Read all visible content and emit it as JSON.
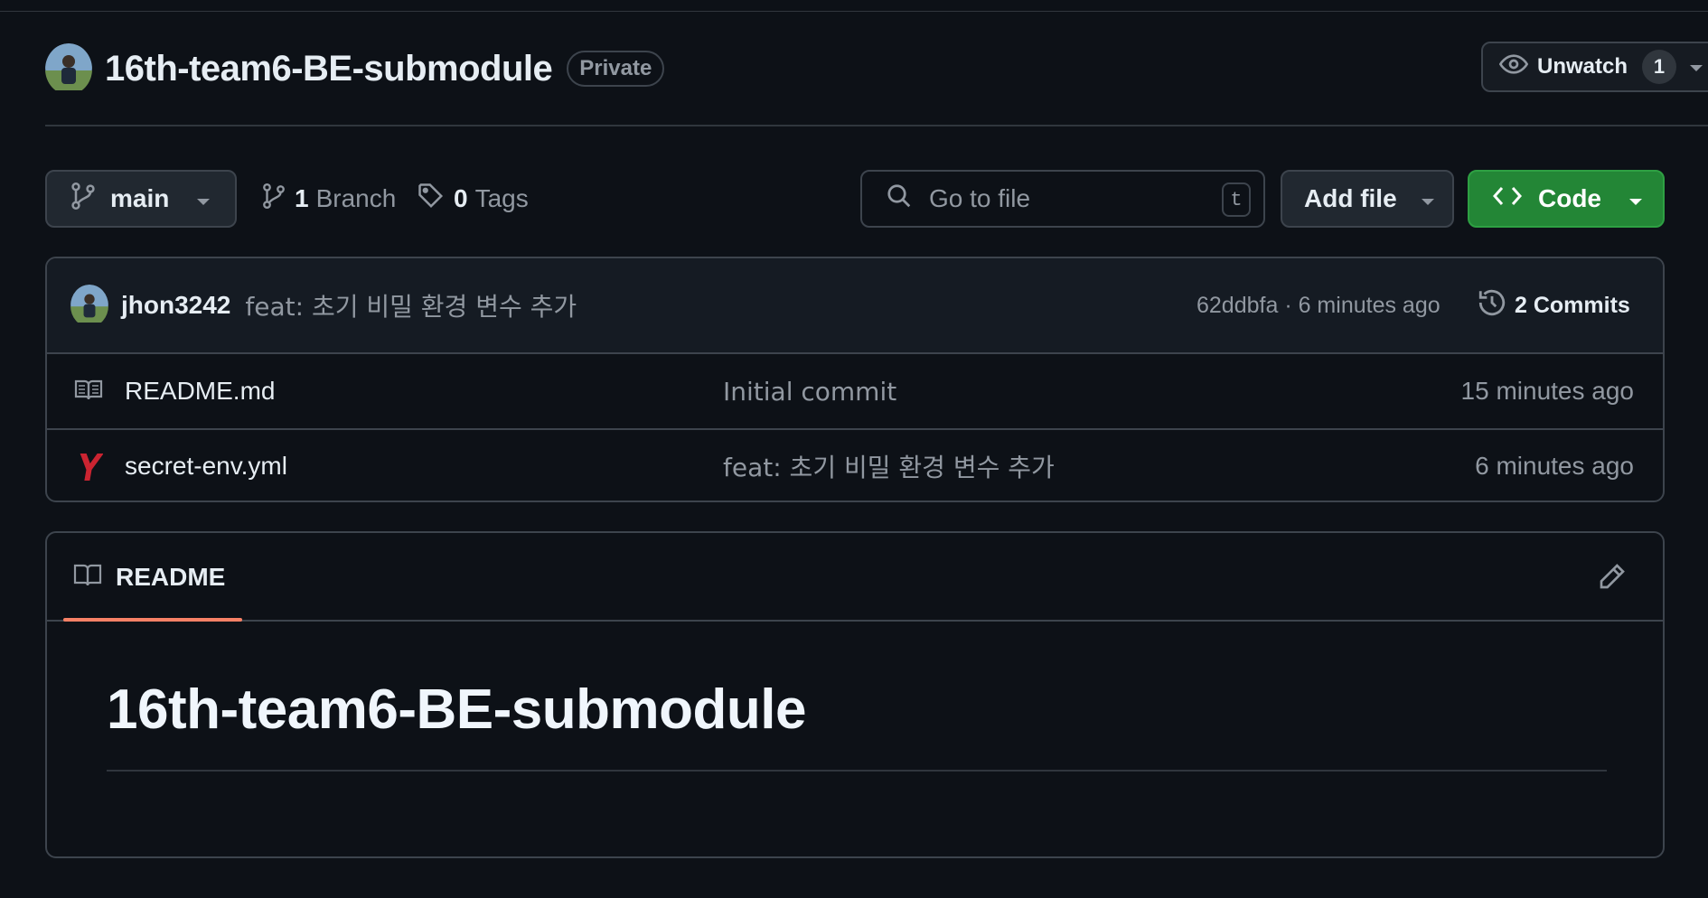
{
  "repo": {
    "name": "16th-team6-BE-submodule",
    "visibility": "Private",
    "watch_label": "Unwatch",
    "watch_count": "1"
  },
  "toolbar": {
    "branch": "main",
    "branches_count": "1",
    "branches_label": "Branch",
    "tags_count": "0",
    "tags_label": "Tags",
    "search_placeholder": "Go to file",
    "search_shortcut": "t",
    "add_file_label": "Add file",
    "code_label": "Code"
  },
  "latest_commit": {
    "author": "jhon3242",
    "message": "feat: 초기 비밀 환경 변수 추가",
    "meta": "62ddbfa · 6 minutes ago",
    "commits_label": "2 Commits"
  },
  "files": [
    {
      "name": "README.md",
      "message": "Initial commit",
      "time": "15 minutes ago",
      "icon": "book-icon"
    },
    {
      "name": "secret-env.yml",
      "message": "feat: 초기 비밀 환경 변수 추가",
      "time": "6 minutes ago",
      "icon": "yaml-icon"
    }
  ],
  "readme": {
    "tab_label": "README",
    "heading": "16th-team6-BE-submodule"
  },
  "colors": {
    "background": "#0d1117",
    "border": "#3d444d",
    "accent_green": "#238636",
    "tab_underline": "#f78166",
    "yaml_red": "#cb2431"
  }
}
